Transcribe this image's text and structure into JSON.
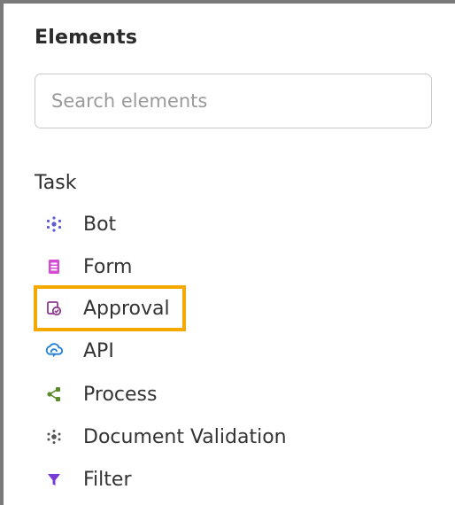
{
  "panel": {
    "title": "Elements",
    "search": {
      "placeholder": "Search elements",
      "value": ""
    },
    "section_label": "Task",
    "items": [
      {
        "label": "Bot",
        "icon": "bot-icon",
        "color": "#5b5bd6"
      },
      {
        "label": "Form",
        "icon": "form-icon",
        "color": "#c43ad6"
      },
      {
        "label": "Approval",
        "icon": "approval-icon",
        "color": "#8e3a8e",
        "highlighted": true
      },
      {
        "label": "API",
        "icon": "api-icon",
        "color": "#1e7fd6"
      },
      {
        "label": "Process",
        "icon": "process-icon",
        "color": "#5a8a2a"
      },
      {
        "label": "Document Validation",
        "icon": "document-validation-icon",
        "color": "#555555"
      },
      {
        "label": "Filter",
        "icon": "filter-icon",
        "color": "#7a3ad6"
      }
    ],
    "highlight_color": "#f5a800"
  }
}
